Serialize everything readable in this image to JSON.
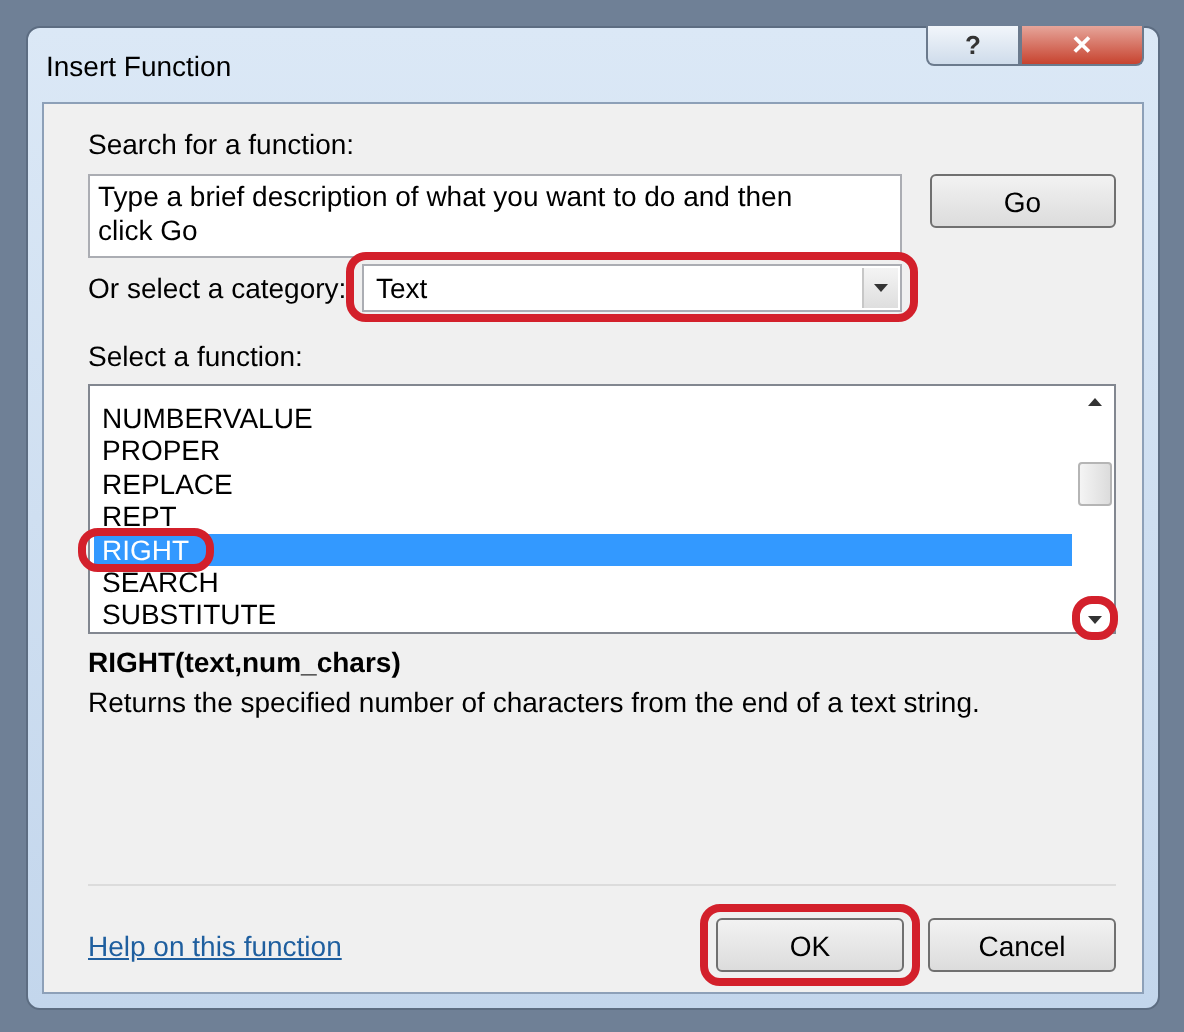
{
  "window": {
    "title": "Insert Function",
    "help_button": "?",
    "close_button": "✕"
  },
  "search": {
    "label": "Search for a function:",
    "value": "Type a brief description of what you want to do and then click Go",
    "go_button": "Go"
  },
  "category": {
    "label": "Or select a category:",
    "value": "Text",
    "highlighted": true
  },
  "function_list": {
    "label": "Select a function:",
    "scroll_down_highlighted": true,
    "items": [
      {
        "name": "NUMBERVALUE",
        "selected": false,
        "highlighted": false
      },
      {
        "name": "PROPER",
        "selected": false,
        "highlighted": false
      },
      {
        "name": "REPLACE",
        "selected": false,
        "highlighted": false
      },
      {
        "name": "REPT",
        "selected": false,
        "highlighted": false
      },
      {
        "name": "RIGHT",
        "selected": true,
        "highlighted": true
      },
      {
        "name": "SEARCH",
        "selected": false,
        "highlighted": false
      },
      {
        "name": "SUBSTITUTE",
        "selected": false,
        "highlighted": false
      }
    ]
  },
  "signature": "RIGHT(text,num_chars)",
  "description": "Returns the specified number of characters from the end of a text string.",
  "help_link": "Help on this function",
  "buttons": [
    {
      "label": "OK",
      "highlighted": true
    },
    {
      "label": "Cancel",
      "highlighted": false
    }
  ]
}
